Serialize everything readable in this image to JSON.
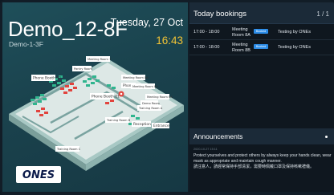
{
  "room": {
    "name": "Demo_12-8F",
    "floor": "Demo-1-3F",
    "date": "Tuesday, 27 Oct",
    "time": "16:43"
  },
  "floorplan": {
    "labels": {
      "meeting_room_7": "Meeting Room 7",
      "pantry_room": "Pantry Room",
      "phone_booth_02": "Phone Booth 02",
      "meeting_room_8b": "Meeting Room 8B",
      "phone_booth_03": "Phone Bo",
      "meeting_room_8a": "Meeting Room 8A",
      "phone_booth_01": "Phone Booth 01",
      "meeting_room_6a": "Meeting Room 6A",
      "demo_room": "Demo Room",
      "training_room_a": "Training Room A",
      "training_room_b": "Training Room B",
      "reception": "Reception",
      "entrance": "Entrance",
      "training_room_c": "Training Room C"
    }
  },
  "brand": {
    "logo_text": "ONES"
  },
  "bookings": {
    "title": "Today bookings",
    "page": "1 / 1",
    "items": [
      {
        "time": "17:00 - 18:00",
        "room_line1": "Meeting",
        "room_line2": "Room 8A",
        "badge": "Booked",
        "subject": "Testing by ONEs"
      },
      {
        "time": "17:00 - 18:00",
        "room_line1": "Meeting",
        "room_line2": "Room 8B",
        "badge": "Booked",
        "subject": "Testing by ONEs"
      }
    ]
  },
  "announcements": {
    "title": "Announcements",
    "meta": "2020-10-27 15:11",
    "text": "Protect yourselves and protect others by always keep your hands clean, wear mask as appropriate and maintain cough manner.",
    "text_zh": "請注意人，請經常保持手部清潔，需要時佩戴口罩及保持咳嗽禮儀。"
  },
  "colors": {
    "accent_time": "#f2c335",
    "badge_blue": "#2d8de8",
    "panel_header": "#1b2a38"
  }
}
